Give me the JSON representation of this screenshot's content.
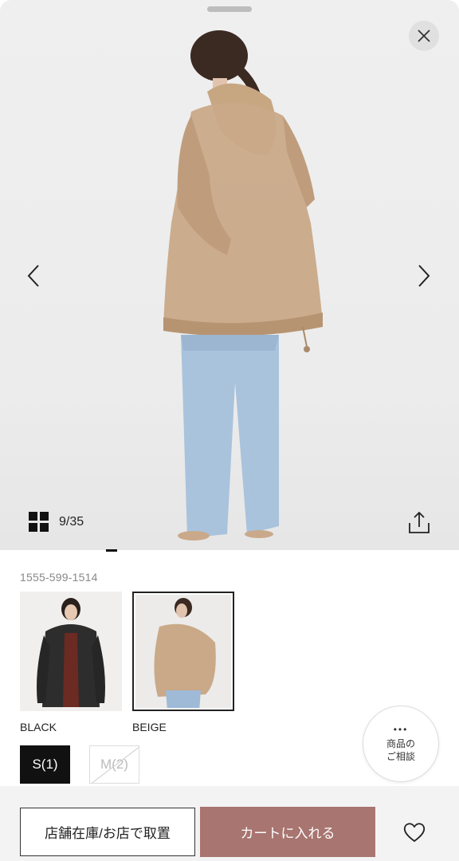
{
  "gallery": {
    "counter": "9/35"
  },
  "product": {
    "code": "1555-599-1514",
    "colors": [
      {
        "label": "BLACK"
      },
      {
        "label": "BEIGE"
      }
    ],
    "sizes": [
      {
        "label": "S(1)"
      },
      {
        "label": "M(2)"
      }
    ]
  },
  "consult": {
    "dots": "•••",
    "line1": "商品の",
    "line2": "ご相談"
  },
  "actions": {
    "store_label": "店舗在庫/お店で取置",
    "cart_label": "カートに入れる"
  },
  "colors": {
    "cart_button": "#a87570",
    "selected_size": "#111111"
  }
}
